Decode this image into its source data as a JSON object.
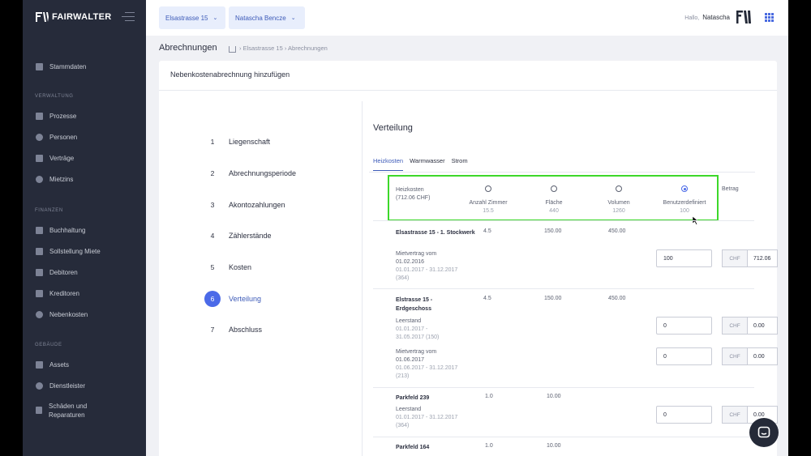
{
  "app": {
    "brand": "FAIRWALTER"
  },
  "sidebar": {
    "top_items": [
      {
        "label": "Stammdaten",
        "icon": "database-icon"
      }
    ],
    "sections": [
      {
        "title": "VERWALTUNG",
        "items": [
          {
            "label": "Prozesse",
            "icon": "process-icon"
          },
          {
            "label": "Personen",
            "icon": "people-icon"
          },
          {
            "label": "Verträge",
            "icon": "contract-icon"
          },
          {
            "label": "Mietzins",
            "icon": "rent-icon"
          }
        ]
      },
      {
        "title": "FINANZEN",
        "items": [
          {
            "label": "Buchhaltung",
            "icon": "ledger-icon"
          },
          {
            "label": "Sollstellung Miete",
            "icon": "invoice-icon"
          },
          {
            "label": "Debitoren",
            "icon": "debtors-icon"
          },
          {
            "label": "Kreditoren",
            "icon": "creditors-icon"
          },
          {
            "label": "Nebenkosten",
            "icon": "utilities-icon"
          }
        ]
      },
      {
        "title": "GEBÄUDE",
        "items": [
          {
            "label": "Assets",
            "icon": "assets-icon"
          },
          {
            "label": "Dienstleister",
            "icon": "service-provider-icon"
          },
          {
            "label": "Schäden und Reparaturen",
            "icon": "repairs-icon"
          }
        ]
      }
    ]
  },
  "topbar": {
    "property_select": "Elsastrasse 15",
    "user_select": "Natascha Bencze",
    "greeting": "Hallo,",
    "user_name": "Natascha"
  },
  "breadcrumb": {
    "page_title": "Abrechnungen",
    "path": "› Elsastrasse 15 › Abrechnungen"
  },
  "card": {
    "title": "Nebenkostenabrechnung hinzufügen"
  },
  "steps": [
    {
      "num": "1",
      "label": "Liegenschaft"
    },
    {
      "num": "2",
      "label": "Abrechnungsperiode"
    },
    {
      "num": "3",
      "label": "Akontozahlungen"
    },
    {
      "num": "4",
      "label": "Zählerstände"
    },
    {
      "num": "5",
      "label": "Kosten"
    },
    {
      "num": "6",
      "label": "Verteilung",
      "active": true
    },
    {
      "num": "7",
      "label": "Abschluss"
    }
  ],
  "verteilung": {
    "title": "Verteilung",
    "tabs": [
      "Heizkosten",
      "Warmwasser",
      "Strom"
    ],
    "active_tab": "Heizkosten",
    "cost_label": "Heizkosten",
    "cost_amount": "(712.06 CHF)",
    "options": [
      {
        "label": "Anzahl Zimmer",
        "total": "15.5",
        "selected": false
      },
      {
        "label": "Fläche",
        "total": "440",
        "selected": false
      },
      {
        "label": "Volumen",
        "total": "1260",
        "selected": false
      },
      {
        "label": "Benutzerdefiniert",
        "total": "100",
        "selected": true
      }
    ],
    "betrag_label": "Betrag",
    "currency": "CHF",
    "units": [
      {
        "name": "Elsastrasse 15 - 1. Stockwerk",
        "rooms": "4.5",
        "area": "150.00",
        "volume": "450.00",
        "tenancies": [
          {
            "label": "Mietvertrag vom 01.02.2016",
            "period": "01.01.2017 - 31.12.2017 (364)",
            "custom": "100",
            "amount": "712.06"
          }
        ]
      },
      {
        "name": "Elstrasse 15 - Erdgeschoss",
        "rooms": "4.5",
        "area": "150.00",
        "volume": "450.00",
        "tenancies": [
          {
            "label": "Leerstand",
            "period": "01.01.2017 - 31.05.2017 (150)",
            "custom": "0",
            "amount": "0.00"
          },
          {
            "label": "Mietvertrag vom 01.06.2017",
            "period": "01.06.2017 - 31.12.2017 (213)",
            "custom": "0",
            "amount": "0.00"
          }
        ]
      },
      {
        "name": "Parkfeld 239",
        "rooms": "1.0",
        "area": "10.00",
        "volume": "",
        "tenancies": [
          {
            "label": "Leerstand",
            "period": "01.01.2017 - 31.12.2017 (364)",
            "custom": "0",
            "amount": "0.00"
          }
        ]
      },
      {
        "name": "Parkfeld 164",
        "rooms": "1.0",
        "area": "10.00",
        "volume": "",
        "tenancies": []
      }
    ]
  },
  "colors": {
    "sidebar_bg": "#262b3a",
    "accent": "#4b6ae8",
    "highlight_box": "#3dd82a"
  }
}
